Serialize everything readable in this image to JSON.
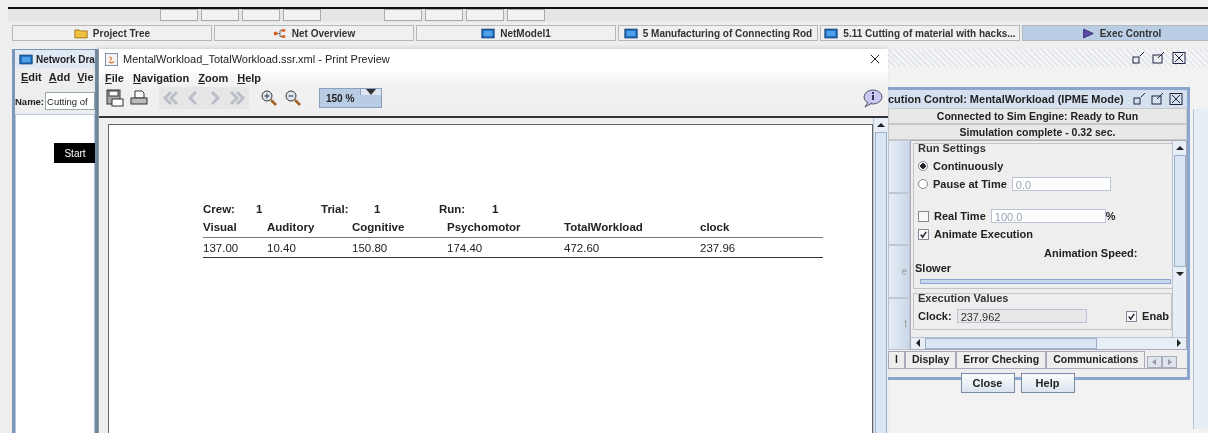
{
  "top_tabs": [
    {
      "label": "Project Tree",
      "kind": "folder",
      "selected": false
    },
    {
      "label": "Net Overview",
      "kind": "network",
      "selected": false
    },
    {
      "label": "NetModel1",
      "kind": "window",
      "selected": false
    },
    {
      "label": "5 Manufacturing of Connecting Rod",
      "kind": "window",
      "selected": false
    },
    {
      "label": "5.11 Cutting of material with hacks...",
      "kind": "window",
      "selected": false
    },
    {
      "label": "Exec Control",
      "kind": "play",
      "selected": true
    }
  ],
  "network_window": {
    "title": "Network Dra",
    "menu": [
      "Edit",
      "Add",
      "Vie"
    ],
    "name_label": "Name:",
    "name_value": "Cutting of",
    "nodes": [
      {
        "label": "Start"
      }
    ]
  },
  "preview_window": {
    "title": "MentalWorkload_TotalWorkload.ssr.xml - Print Preview",
    "menu": [
      "File",
      "Navigation",
      "Zoom",
      "Help"
    ],
    "tools": [
      {
        "kind": "save",
        "disabled": false
      },
      {
        "kind": "print",
        "disabled": false
      },
      {
        "kind": "first",
        "disabled": true
      },
      {
        "kind": "previous",
        "disabled": true
      },
      {
        "kind": "next",
        "disabled": true
      },
      {
        "kind": "last",
        "disabled": true
      },
      {
        "kind": "zoomin",
        "disabled": false
      },
      {
        "kind": "zoomout",
        "disabled": false
      }
    ],
    "zoom": "150 %",
    "report": {
      "header": [
        {
          "label": "Crew:",
          "value": "1"
        },
        {
          "label": "Trial:",
          "value": "1"
        },
        {
          "label": "Run:",
          "value": "1"
        }
      ],
      "columns": [
        "Visual",
        "Auditory",
        "Cognitive",
        "Psychomotor",
        "TotalWorkload",
        "clock"
      ],
      "rows": [
        [
          "137.00",
          "10.40",
          "150.80",
          "174.40",
          "472.60",
          "237.96"
        ]
      ]
    }
  },
  "exec_control": {
    "title": "cution Control: MentalWorkload  (IPME Mode)",
    "status": [
      "Connected to Sim Engine: Ready to Run",
      "Simulation complete - 0.32 sec."
    ],
    "side_buttons": [
      "e",
      "t"
    ],
    "run_settings": {
      "title": "Run Settings",
      "options": [
        {
          "label": "Continuously",
          "selected": true
        },
        {
          "label": "Pause at Time",
          "selected": false,
          "value": "0.0"
        }
      ],
      "real_time": {
        "label": "Real Time",
        "checked": false,
        "value": "100.0",
        "unit": "%"
      },
      "animate": {
        "label": "Animate Execution",
        "checked": true
      },
      "speed_label": "Animation Speed:",
      "slower_label": "Slower"
    },
    "execution_values": {
      "title": "Execution Values",
      "clock_label": "Clock:",
      "clock_value": "237.962",
      "enable": {
        "label": "Enab",
        "checked": true
      }
    },
    "tabs": [
      {
        "label": "l",
        "selected": false
      },
      {
        "label": "Display",
        "selected": false
      },
      {
        "label": "Error Checking",
        "selected": false
      },
      {
        "label": "Communications",
        "selected": false
      }
    ],
    "buttons": [
      "Close",
      "Help"
    ]
  }
}
